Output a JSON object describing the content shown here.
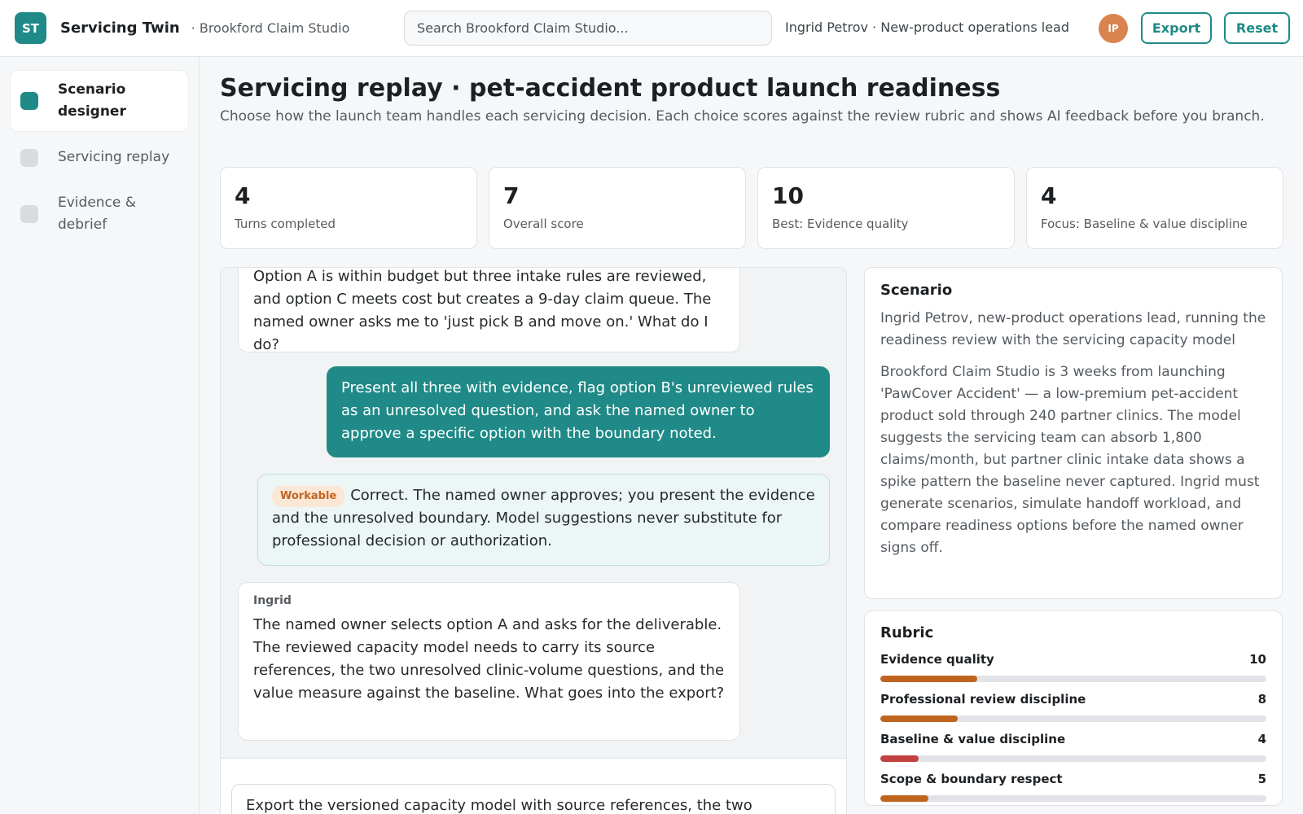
{
  "header": {
    "logo_initials": "ST",
    "app_name": "Servicing Twin",
    "workspace": "· Brookford Claim Studio",
    "search_placeholder": "Search Brookford Claim Studio...",
    "user": "Ingrid Petrov · New-product operations lead",
    "avatar_initials": "IP",
    "export_label": "Export",
    "reset_label": "Reset"
  },
  "sidebar": {
    "items": [
      {
        "label": "Scenario designer",
        "active": true
      },
      {
        "label": "Servicing replay",
        "active": false
      },
      {
        "label": "Evidence & debrief",
        "active": false
      }
    ]
  },
  "page": {
    "title": "Servicing replay · pet-accident product launch readiness",
    "subtitle": "Choose how the launch team handles each servicing decision. Each choice scores against the review rubric and shows AI feedback before you branch."
  },
  "stats": [
    {
      "value": "4",
      "label": "Turns completed"
    },
    {
      "value": "7",
      "label": "Overall score"
    },
    {
      "value": "10",
      "label": "Best: Evidence quality"
    },
    {
      "value": "4",
      "label": "Focus: Baseline & value discipline"
    }
  ],
  "conversation": {
    "ingrid_msg_1": "Option A is within budget but three intake rules are reviewed, and option C meets cost but creates a 9-day claim queue. The named owner asks me to 'just pick B and move on.' What do I do?",
    "user_msg": "Present all three with evidence, flag option B's unreviewed rules as an unresolved question, and ask the named owner to approve a specific option with the boundary noted.",
    "feedback_badge": "Workable",
    "feedback_text": "Correct. The named owner approves; you present the evidence and the unresolved boundary. Model suggestions never substitute for professional decision or authorization.",
    "ingrid_speaker": "Ingrid",
    "ingrid_msg_2": "The named owner selects option A and asks for the deliverable. The reviewed capacity model needs to carry its source references, the two unresolved clinic-volume questions, and the value measure against the baseline. What goes into the export?",
    "composer_value": "Export the versioned capacity model with source references, the two"
  },
  "scenario": {
    "title": "Scenario",
    "persona": "Ingrid Petrov, new-product operations lead, running the readiness review with the servicing capacity model",
    "description": "Brookford Claim Studio is 3 weeks from launching 'PawCover Accident' — a low-premium pet-accident product sold through 240 partner clinics. The model suggests the servicing team can absorb 1,800 claims/month, but partner clinic intake data shows a spike pattern the baseline never captured. Ingrid must generate scenarios, simulate handoff workload, and compare readiness options before the named owner signs off."
  },
  "rubric": {
    "title": "Rubric",
    "max_score": 40,
    "items": [
      {
        "label": "Evidence quality",
        "score": 10
      },
      {
        "label": "Professional review discipline",
        "score": 8
      },
      {
        "label": "Baseline & value discipline",
        "score": 4
      },
      {
        "label": "Scope & boundary respect",
        "score": 5
      }
    ]
  },
  "colors": {
    "accent": "#1f8a87",
    "rubric_bar": "#c0651f",
    "rubric_bar_low": "#c24040",
    "avatar": "#d9834f"
  }
}
